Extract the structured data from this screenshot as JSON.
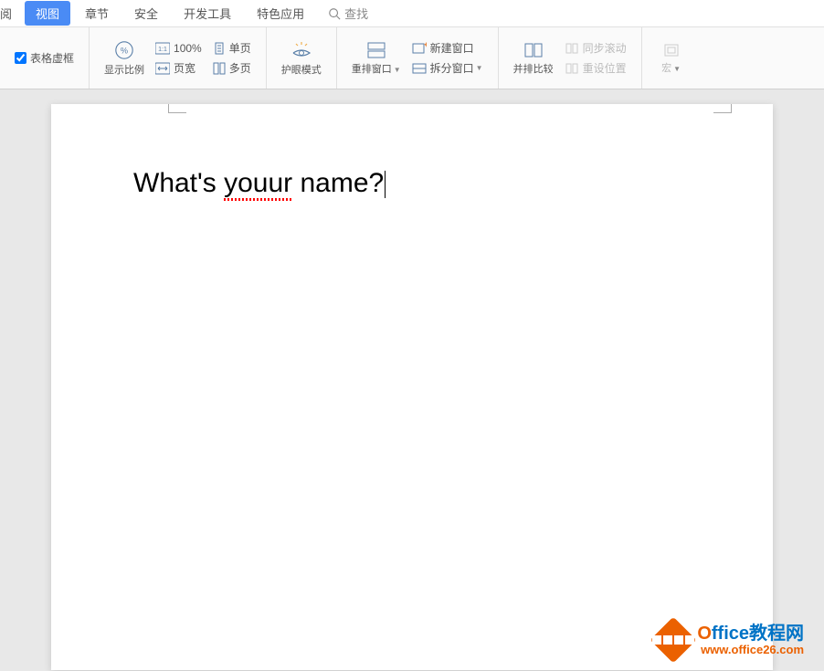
{
  "menubar": {
    "partial_tab": "阅",
    "active_tab": "视图",
    "tabs": [
      "章节",
      "安全",
      "开发工具",
      "特色应用"
    ],
    "search": "查找"
  },
  "ribbon": {
    "checkbox_label": "表格虚框",
    "zoom_ratio": "显示比例",
    "zoom_100": "100%",
    "single_page": "单页",
    "page_width": "页宽",
    "multi_page": "多页",
    "eye_protect": "护眼模式",
    "rearrange": "重排窗口",
    "new_window": "新建窗口",
    "split_window": "拆分窗口",
    "side_by_side": "并排比较",
    "sync_scroll": "同步滚动",
    "reset_pos": "重设位置",
    "macro": "宏"
  },
  "document": {
    "text_before": "What's ",
    "text_error": "youur",
    "text_after": " name?"
  },
  "watermark": {
    "line1_o": "O",
    "line1_rest": "ffice教程网",
    "line2": "www.office26.com"
  }
}
